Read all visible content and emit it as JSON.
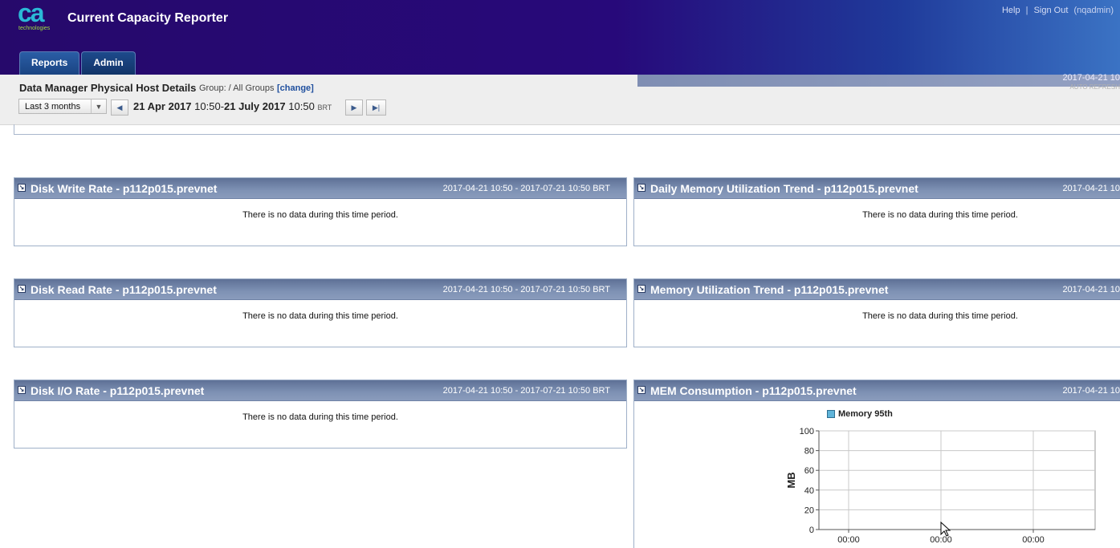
{
  "header": {
    "logo_main": "ca",
    "logo_sub": "technologies",
    "app_title": "Current Capacity Reporter",
    "links": {
      "help": "Help",
      "sep": "|",
      "sign_out": "Sign Out",
      "user": "(nqadmin)"
    },
    "tabs": [
      {
        "label": "Reports"
      },
      {
        "label": "Admin"
      }
    ]
  },
  "subheader": {
    "page_title": "Data Manager Physical Host Details",
    "group_label": "Group: / All Groups",
    "change_link": "[change]",
    "range_select": "Last 3 months",
    "start_date": "21 Apr 2017",
    "start_time": "10:50",
    "dash": "-",
    "end_date": "21 July 2017",
    "end_time": "10:50",
    "tz": "BRT",
    "right_date": "2017-04-21 10",
    "auto_refresh": "AUTO REFRESH"
  },
  "icons": {
    "prev": "prev-arrow-icon",
    "next": "next-arrow-icon",
    "last": "last-arrow-icon",
    "expand": "expand-icon"
  },
  "panels": {
    "disk_write": {
      "title": "Disk Write Rate - p112p015.prevnet",
      "range": "2017-04-21 10:50 - 2017-07-21 10:50 BRT",
      "message": "There is no data during this time period."
    },
    "daily_mem": {
      "title": "Daily Memory Utilization Trend - p112p015.prevnet",
      "range": "2017-04-21 10",
      "message": "There is no data during this time period."
    },
    "disk_read": {
      "title": "Disk Read Rate - p112p015.prevnet",
      "range": "2017-04-21 10:50 - 2017-07-21 10:50 BRT",
      "message": "There is no data during this time period."
    },
    "mem_util": {
      "title": "Memory Utilization Trend - p112p015.prevnet",
      "range": "2017-04-21 10",
      "message": "There is no data during this time period."
    },
    "disk_io": {
      "title": "Disk I/O Rate - p112p015.prevnet",
      "range": "2017-04-21 10:50 - 2017-07-21 10:50 BRT",
      "message": "There is no data during this time period."
    },
    "mem_cons": {
      "title": "MEM Consumption - p112p015.prevnet",
      "range": "2017-04-21 10"
    }
  },
  "chart_data": {
    "type": "line",
    "title": "",
    "ylabel": "MB",
    "xlabel": "",
    "ylim": [
      0,
      100
    ],
    "yticks": [
      0,
      20,
      40,
      60,
      80,
      100
    ],
    "x": [
      "00:00",
      "00:00",
      "00:00"
    ],
    "series": [
      {
        "name": "Memory 95th",
        "values": []
      }
    ],
    "legend": "top",
    "grid": true,
    "colors": {
      "series": "#5fb4d9"
    }
  }
}
